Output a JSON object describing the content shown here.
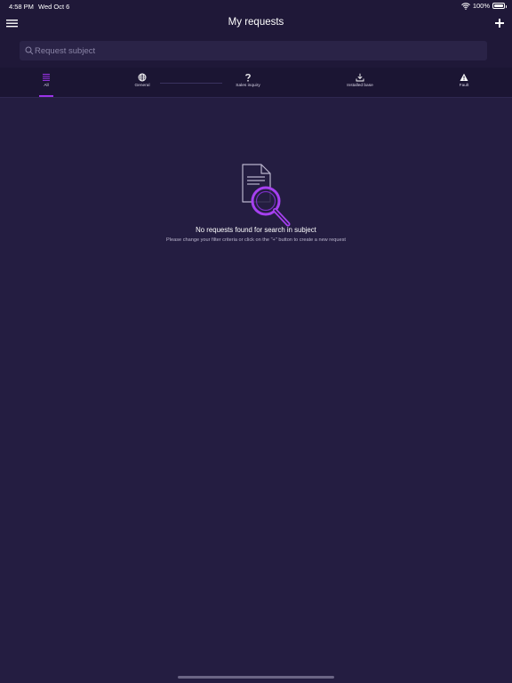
{
  "status_bar": {
    "time": "4:58 PM",
    "date": "Wed Oct 6",
    "battery": "100%"
  },
  "header": {
    "title": "My requests",
    "menu_icon": "hamburger-menu-icon",
    "add_icon": "plus-icon"
  },
  "search": {
    "placeholder": "Request subject",
    "value": ""
  },
  "tabs": [
    {
      "label": "All",
      "icon": "list-icon",
      "selected": true
    },
    {
      "label": "General",
      "icon": "globe-icon",
      "selected": false
    },
    {
      "label": "Sales inquiry",
      "icon": "question-mark-icon",
      "selected": false
    },
    {
      "label": "Installed base",
      "icon": "download-icon",
      "selected": false
    },
    {
      "label": "Fault",
      "icon": "warning-icon",
      "selected": false
    }
  ],
  "empty_state": {
    "icon": "document-search-icon",
    "title": "No requests found for search in subject",
    "subtitle": "Please change your filter criteria or click on the \"+\" button to create a new request"
  },
  "colors": {
    "background": "#241d41",
    "header_background": "#1f1838",
    "tab_bar_background": "#1b1533",
    "accent": "#9b33e8"
  }
}
